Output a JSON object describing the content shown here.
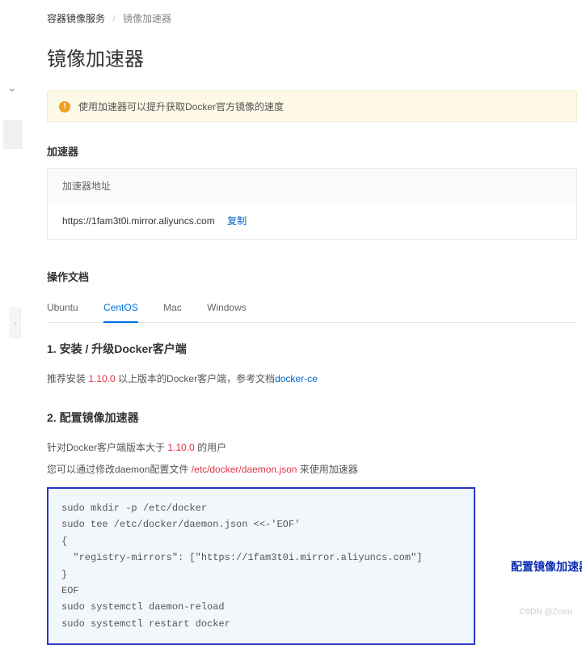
{
  "breadcrumb": {
    "root": "容器镜像服务",
    "current": "镜像加速器"
  },
  "page_title": "镜像加速器",
  "alert_text": "使用加速器可以提升获取Docker官方镜像的速度",
  "accelerator": {
    "section_label": "加速器",
    "header": "加速器地址",
    "url": "https://1fam3t0i.mirror.aliyuncs.com",
    "copy_label": "复制"
  },
  "docs": {
    "section_label": "操作文档",
    "tabs": [
      "Ubuntu",
      "CentOS",
      "Mac",
      "Windows"
    ],
    "active_tab": "CentOS"
  },
  "step1": {
    "title": "1. 安装 / 升级Docker客户端",
    "desc_prefix": "推荐安装 ",
    "version": "1.10.0",
    "desc_mid": " 以上版本的Docker客户端，参考文档",
    "doc_link": "docker-ce"
  },
  "step2": {
    "title": "2. 配置镜像加速器",
    "line1_prefix": "针对Docker客户端版本大于 ",
    "line1_ver": "1.10.0",
    "line1_suffix": " 的用户",
    "line2_prefix": "您可以通过修改daemon配置文件 ",
    "path": "/etc/docker/daemon.json",
    "line2_suffix": " 来使用加速器",
    "code": "sudo mkdir -p /etc/docker\nsudo tee /etc/docker/daemon.json <<-'EOF'\n{\n  \"registry-mirrors\": [\"https://1fam3t0i.mirror.aliyuncs.com\"]\n}\nEOF\nsudo systemctl daemon-reload\nsudo systemctl restart docker",
    "side_label": "配置镜像加速器"
  },
  "watermark": "CSDN @Zcien"
}
